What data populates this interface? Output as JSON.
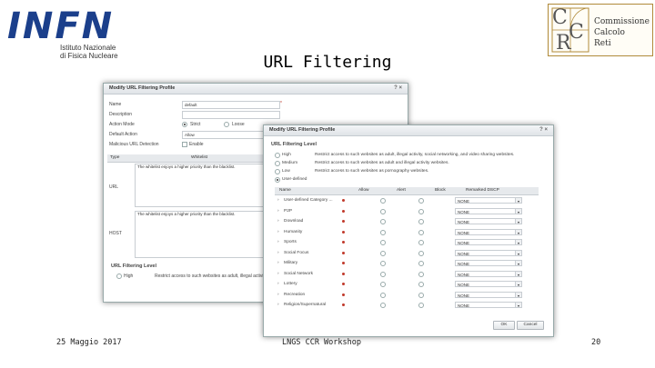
{
  "logos": {
    "infn_name": "INFN",
    "infn_line1": "Istituto Nazionale",
    "infn_line2": "di Fisica Nucleare",
    "ccr_letters": [
      "C",
      "C",
      "R"
    ],
    "ccr_line1": "Commissione",
    "ccr_line2": "Calcolo",
    "ccr_line3": "Reti"
  },
  "slide": {
    "title": "URL Filtering"
  },
  "back_dialog": {
    "title": "Modify URL Filtering Profile",
    "controls": "? ×",
    "fields": {
      "name_label": "Name",
      "name_value": "default",
      "required_mark": "*",
      "description_label": "Description",
      "action_mode_label": "Action Mode",
      "strict": "Strict",
      "loose": "Loose",
      "default_action_label": "Default Action",
      "default_action_value": "Allow",
      "malicious_label": "Malicious URL Detection",
      "enable": "Enable"
    },
    "grid": {
      "type_header": "Type",
      "whitelist_header": "Whitelist",
      "url_label": "URL",
      "host_label": "HOST",
      "url_hint": "The whitelist enjoys a higher priority than the blacklist.",
      "host_hint": "The whitelist enjoys a higher priority than the blacklist."
    },
    "level": {
      "section": "URL Filtering Level",
      "high": "High",
      "high_desc": "Restrict access to such websites as adult, illegal activit..."
    }
  },
  "front_dialog": {
    "title": "Modify URL Filtering Profile",
    "controls": "? ×",
    "section": "URL Filtering Level",
    "levels": [
      {
        "name": "High",
        "desc": "Restrict access to such websites as adult, illegal activity, social networking, and video sharing websites.",
        "selected": false
      },
      {
        "name": "Medium",
        "desc": "Restrict access to such websites as adult and illegal activity websites.",
        "selected": false
      },
      {
        "name": "Low",
        "desc": "Restrict access to such websites as pornography websites.",
        "selected": false
      },
      {
        "name": "User-defined",
        "desc": "",
        "selected": true
      }
    ],
    "table": {
      "headers": [
        "Name",
        "Allow",
        "Alert",
        "Block",
        "Remarked DSCP"
      ],
      "rows": [
        {
          "name": "User-defined Category ...",
          "dscp": "NONE"
        },
        {
          "name": "P2P",
          "dscp": "NONE"
        },
        {
          "name": "Download",
          "dscp": "NONE"
        },
        {
          "name": "Humanity",
          "dscp": "NONE"
        },
        {
          "name": "Sports",
          "dscp": "NONE"
        },
        {
          "name": "Social Focus",
          "dscp": "NONE"
        },
        {
          "name": "Military",
          "dscp": "NONE"
        },
        {
          "name": "Social Network",
          "dscp": "NONE"
        },
        {
          "name": "Lottery",
          "dscp": "NONE"
        },
        {
          "name": "Recreation",
          "dscp": "NONE"
        },
        {
          "name": "Religion/Supernatural",
          "dscp": "NONE"
        }
      ]
    },
    "ok_label": "OK",
    "cancel_label": "Cancel"
  },
  "footer": {
    "date": "25 Maggio 2017",
    "event": "LNGS CCR Workshop",
    "page": "20"
  }
}
